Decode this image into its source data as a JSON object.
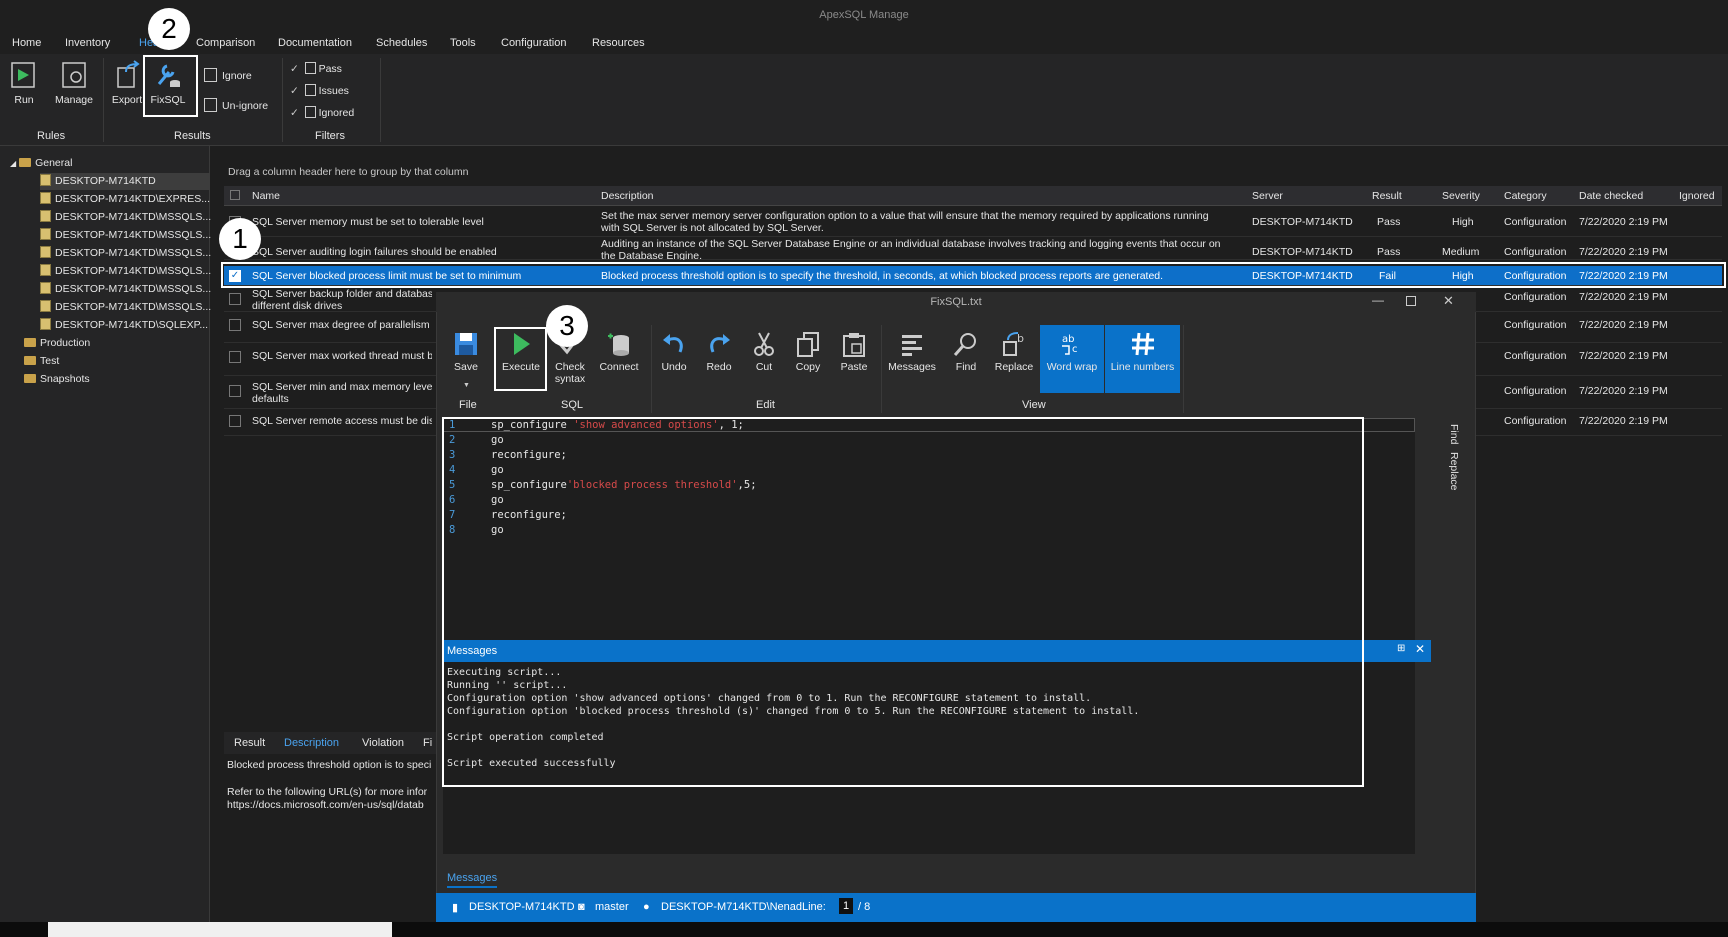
{
  "app": {
    "title": "ApexSQL Manage"
  },
  "menu": [
    "Home",
    "Inventory",
    "Health",
    "Comparison",
    "Documentation",
    "Schedules",
    "Tools",
    "Configuration",
    "Resources"
  ],
  "ribbon": {
    "rules": {
      "label": "Rules",
      "run": "Run",
      "manage": "Manage"
    },
    "results": {
      "label": "Results",
      "export": "Export",
      "fixsql": "FixSQL",
      "ignore": "Ignore",
      "unignore": "Un-ignore"
    },
    "filters": {
      "label": "Filters",
      "pass": "Pass",
      "issues": "Issues",
      "ignored": "Ignored"
    }
  },
  "tree": {
    "general": "General",
    "servers": [
      "DESKTOP-M714KTD",
      "DESKTOP-M714KTD\\EXPRES...",
      "DESKTOP-M714KTD\\MSSQLS...",
      "DESKTOP-M714KTD\\MSSQLS...",
      "DESKTOP-M714KTD\\MSSQLS...",
      "DESKTOP-M714KTD\\MSSQLS...",
      "DESKTOP-M714KTD\\MSSQLS...",
      "DESKTOP-M714KTD\\MSSQLS...",
      "DESKTOP-M714KTD\\SQLEXP..."
    ],
    "production": "Production",
    "test": "Test",
    "snapshots": "Snapshots"
  },
  "grid": {
    "group_hint": "Drag a column header here to group by that column",
    "headers": {
      "name": "Name",
      "description": "Description",
      "server": "Server",
      "result": "Result",
      "severity": "Severity",
      "category": "Category",
      "date": "Date checked",
      "ignored": "Ignored"
    },
    "rows": [
      {
        "name": "SQL Server memory must be set to tolerable level",
        "desc1": "Set the max server memory server configuration option to a value that will ensure that the memory required by applications running",
        "desc2": "with SQL Server is not allocated by SQL Server.",
        "server": "DESKTOP-M714KTD",
        "result": "Pass",
        "severity": "High",
        "category": "Configuration",
        "date": "7/22/2020 2:19 PM"
      },
      {
        "name": "SQL Server auditing login failures should be enabled",
        "desc1": "Auditing an instance of the SQL Server Database Engine or an individual database involves tracking and logging events that occur on",
        "desc2": "the Database Engine.",
        "server": "DESKTOP-M714KTD",
        "result": "Pass",
        "severity": "Medium",
        "category": "Configuration",
        "date": "7/22/2020 2:19 PM"
      },
      {
        "name": "SQL Server blocked process limit must be set to minimum",
        "desc1": "Blocked process threshold option is to specify the threshold, in seconds, at which blocked process reports are generated.",
        "desc2": "",
        "server": "DESKTOP-M714KTD",
        "result": "Fail",
        "severity": "High",
        "category": "Configuration",
        "date": "7/22/2020 2:19 PM"
      },
      {
        "name": "SQL Server backup folder and database files should be on",
        "desc1": "",
        "desc2": "",
        "server": "",
        "result": "",
        "severity": "",
        "category": "Configuration",
        "date": "7/22/2020 2:19 PM"
      },
      {
        "name": "SQL Server max degree of parallelism",
        "desc1": "",
        "desc2": "",
        "server": "",
        "result": "",
        "severity": "",
        "category": "Configuration",
        "date": "7/22/2020 2:19 PM"
      },
      {
        "name": "SQL Server max worked thread must b",
        "desc1": "",
        "desc2": "",
        "server": "",
        "result": "",
        "severity": "",
        "category": "Configuration",
        "date": "7/22/2020 2:19 PM"
      },
      {
        "name": "SQL Server min and max memory leve",
        "desc1": "",
        "desc2": "",
        "server": "",
        "result": "",
        "severity": "",
        "category": "Configuration",
        "date": "7/22/2020 2:19 PM"
      },
      {
        "name": "SQL Server remote access must be dis",
        "desc1": "",
        "desc2": "",
        "server": "",
        "result": "",
        "severity": "",
        "category": "Configuration",
        "date": "7/22/2020 2:19 PM"
      }
    ],
    "row4_line2": "different disk drives",
    "row7_line2": "defaults"
  },
  "bottom": {
    "tabs": [
      "Result",
      "Description",
      "Violation",
      "Fi"
    ],
    "line1": "Blocked process threshold option is to speci",
    "line2": "Refer to the following URL(s) for more infor",
    "line3": "https://docs.microsoft.com/en-us/sql/datab"
  },
  "fixsql": {
    "title": "FixSQL.txt",
    "toolbar": {
      "save": "Save",
      "execute": "Execute",
      "check": "Check",
      "check2": "syntax",
      "connect": "Connect",
      "undo": "Undo",
      "redo": "Redo",
      "cut": "Cut",
      "copy": "Copy",
      "paste": "Paste",
      "messages": "Messages",
      "find": "Find",
      "replace": "Replace",
      "wordwrap": "Word wrap",
      "linenumbers": "Line numbers"
    },
    "groups": {
      "file": "File",
      "sql": "SQL",
      "edit": "Edit",
      "view": "View"
    },
    "side": {
      "find": "Find",
      "replace": "Replace"
    },
    "code": [
      {
        "n": "1",
        "a": "sp_configure ",
        "s": "'show advanced options'",
        "b": ", 1;"
      },
      {
        "n": "2",
        "a": "go",
        "s": "",
        "b": ""
      },
      {
        "n": "3",
        "a": "reconfigure;",
        "s": "",
        "b": ""
      },
      {
        "n": "4",
        "a": "go",
        "s": "",
        "b": ""
      },
      {
        "n": "5",
        "a": "sp_configure",
        "s": "'blocked process threshold'",
        "b": ",5;"
      },
      {
        "n": "6",
        "a": "go",
        "s": "",
        "b": ""
      },
      {
        "n": "7",
        "a": "reconfigure;",
        "s": "",
        "b": ""
      },
      {
        "n": "8",
        "a": "go",
        "s": "",
        "b": ""
      }
    ],
    "messages_title": "Messages",
    "messages": [
      "Executing script...",
      "Running '' script...",
      "Configuration option 'show advanced options' changed from 0 to 1. Run the RECONFIGURE statement to install.",
      "Configuration option 'blocked process threshold (s)' changed from 0 to 5. Run the RECONFIGURE statement to install.",
      "",
      "Script operation completed",
      "",
      "Script executed successfully"
    ],
    "messages_tab": "Messages",
    "status": {
      "server": "DESKTOP-M714KTD",
      "db": "master",
      "user": "DESKTOP-M714KTD\\Nenad",
      "line_label": "Line:",
      "line": "1",
      "total": "/ 8"
    }
  },
  "badges": [
    "1",
    "2",
    "3"
  ],
  "colors": {
    "accent": "#0a72c9",
    "string": "#d64a4a",
    "linenum": "#4a9ad8"
  }
}
